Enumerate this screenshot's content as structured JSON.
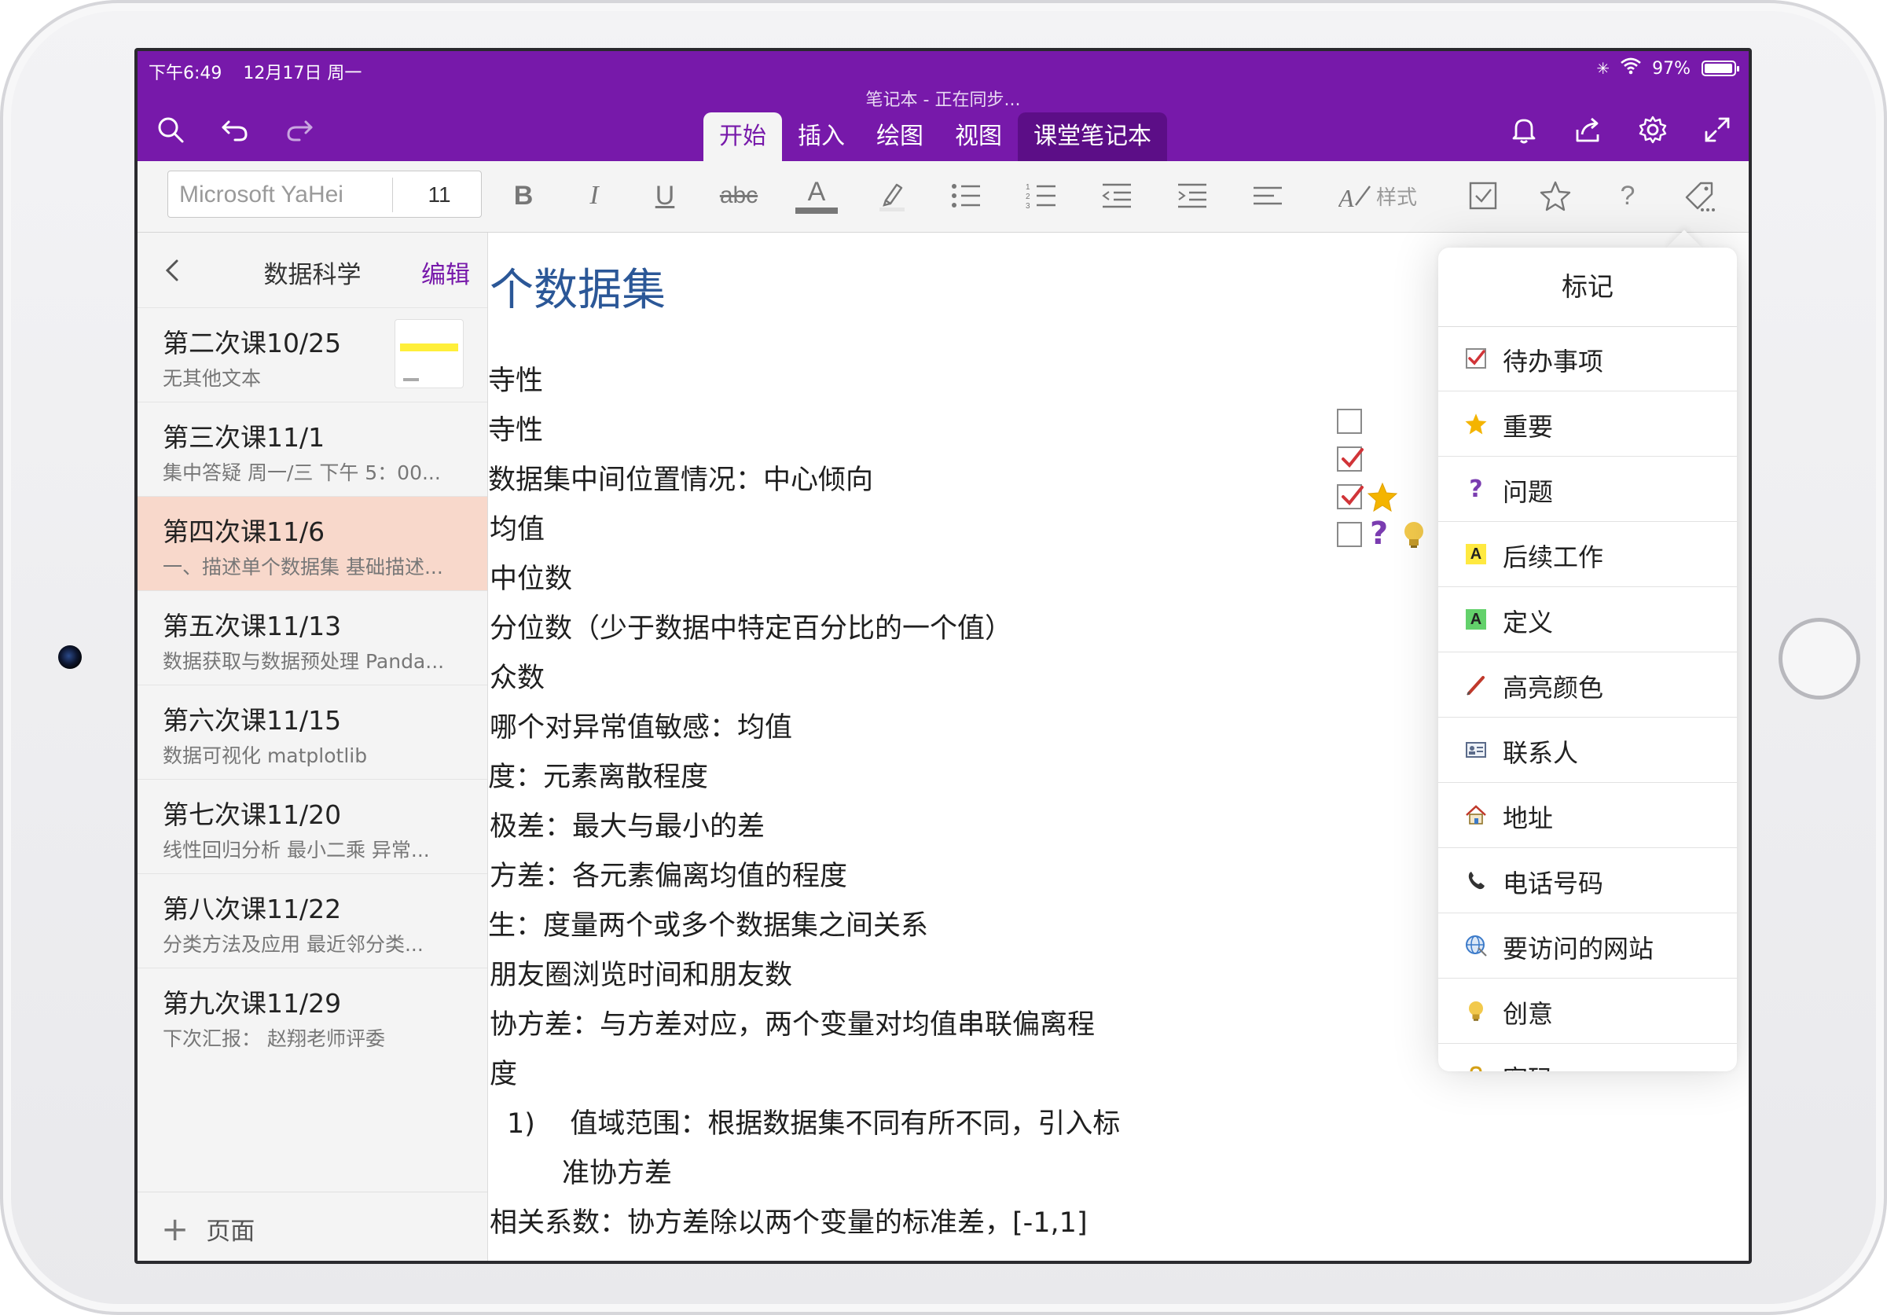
{
  "status_bar": {
    "time": "下午6:49",
    "date": "12月17日 周一",
    "battery": "97%",
    "battery_level": 0.97
  },
  "document_title": "笔记本 - 正在同步...",
  "tabs": [
    {
      "label": "开始",
      "active": true
    },
    {
      "label": "插入",
      "active": false
    },
    {
      "label": "绘图",
      "active": false
    },
    {
      "label": "视图",
      "active": false
    },
    {
      "label": "课堂笔记本",
      "active": false
    }
  ],
  "header_icons": [
    "search-icon",
    "undo-icon",
    "redo-icon",
    "bell-icon",
    "share-icon",
    "gear-icon",
    "expand-icon"
  ],
  "ribbon": {
    "font_name": "Microsoft YaHei",
    "font_size": "11",
    "bold_label": "B",
    "italic_label": "I",
    "underline_label": "U",
    "strike_label": "abc",
    "font_color_label": "A",
    "styles_label": "样式",
    "help_label": "?"
  },
  "sidebar": {
    "title": "数据科学",
    "edit_label": "编辑",
    "add_page_label": "页面",
    "pages": [
      {
        "title": "第二次课10/25",
        "subtitle": "无其他文本",
        "has_thumbnail": true,
        "selected": false
      },
      {
        "title": "第三次课11/1",
        "subtitle": "集中答疑  周一/三 下午 5：00...",
        "selected": false
      },
      {
        "title": "第四次课11/6",
        "subtitle": "一、描述单个数据集  基础描述...",
        "selected": true
      },
      {
        "title": "第五次课11/13",
        "subtitle": "数据获取与数据预处理  Panda...",
        "selected": false
      },
      {
        "title": "第六次课11/15",
        "subtitle": "数据可视化  matplotlib",
        "selected": false
      },
      {
        "title": "第七次课11/20",
        "subtitle": "线性回归分析  最小二乘  异常...",
        "selected": false
      },
      {
        "title": "第八次课11/22",
        "subtitle": "分类方法及应用  最近邻分类...",
        "selected": false
      },
      {
        "title": "第九次课11/29",
        "subtitle": "下次汇报：  赵翔老师评委",
        "selected": false
      }
    ]
  },
  "note": {
    "heading": "个数据集",
    "lines": [
      "寺性",
      "寺性",
      "数据集中间位置情况：中心倾向",
      "均值",
      "中位数",
      "分位数（少于数据中特定百分比的一个值）",
      "众数",
      "哪个对异常值敏感：均值",
      "度：元素离散程度",
      "极差：最大与最小的差",
      "方差：各元素偏离均值的程度",
      "生：度量两个或多个数据集之间关系",
      "朋友圈浏览时间和朋友数",
      "协方差：与方差对应，两个变量对均值串联偏离程",
      "度",
      "1)    值域范围：根据数据集不同有所不同，引入标",
      "准协方差",
      "相关系数：协方差除以两个变量的标准差，[-1,1]"
    ],
    "tag_table": {
      "header": "标记",
      "rows": [
        {
          "number": "1",
          "checked": false,
          "icons": []
        },
        {
          "number": "2",
          "checked": true,
          "icons": []
        },
        {
          "number": "3",
          "checked": true,
          "icons": [
            "star-icon"
          ]
        },
        {
          "number": "4",
          "checked": false,
          "icons": [
            "question-icon",
            "lightbulb-icon"
          ]
        }
      ]
    }
  },
  "tags_popover": {
    "title": "标记",
    "items": [
      {
        "label": "待办事项",
        "icon": "checkbox-icon"
      },
      {
        "label": "重要",
        "icon": "star-icon"
      },
      {
        "label": "问题",
        "icon": "question-icon"
      },
      {
        "label": "后续工作",
        "icon": "follow-up-icon",
        "badge": "A",
        "color": "#ffe940"
      },
      {
        "label": "定义",
        "icon": "definition-icon",
        "badge": "A",
        "color": "#63d16b"
      },
      {
        "label": "高亮颜色",
        "icon": "highlighter-icon"
      },
      {
        "label": "联系人",
        "icon": "contact-icon"
      },
      {
        "label": "地址",
        "icon": "home-icon"
      },
      {
        "label": "电话号码",
        "icon": "phone-icon"
      },
      {
        "label": "要访问的网站",
        "icon": "globe-icon"
      },
      {
        "label": "创意",
        "icon": "lightbulb-icon"
      },
      {
        "label": "密码",
        "icon": "lock-icon"
      }
    ]
  },
  "colors": {
    "accent": "#7719AA",
    "selected_page": "#f8d8cb",
    "heading": "#2b5797"
  }
}
